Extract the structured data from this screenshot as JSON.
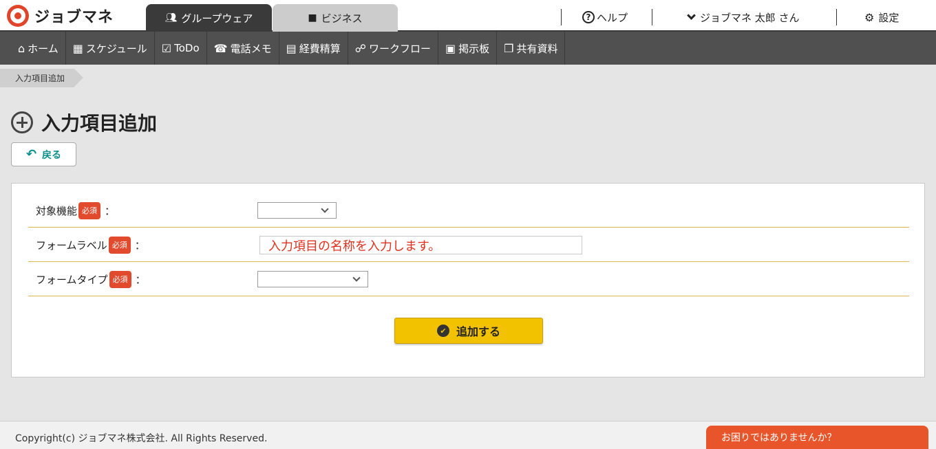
{
  "brand": {
    "name": "ジョブマネ"
  },
  "header": {
    "tabs": [
      {
        "label": "グループウェア",
        "icon": "users-icon",
        "active": true
      },
      {
        "label": "ビジネス",
        "icon": "briefcase-icon",
        "active": false
      }
    ],
    "help_label": "ヘルプ",
    "user_label": "ジョブマネ 太郎 さん",
    "settings_label": "設定"
  },
  "nav": {
    "items": [
      {
        "label": "ホーム",
        "icon": "home-icon"
      },
      {
        "label": "スケジュール",
        "icon": "calendar-icon"
      },
      {
        "label": "ToDo",
        "icon": "clipboard-check-icon"
      },
      {
        "label": "電話メモ",
        "icon": "phone-icon"
      },
      {
        "label": "経費精算",
        "icon": "calculator-icon"
      },
      {
        "label": "ワークフロー",
        "icon": "workflow-icon"
      },
      {
        "label": "掲示板",
        "icon": "board-icon"
      },
      {
        "label": "共有資料",
        "icon": "documents-icon"
      }
    ]
  },
  "breadcrumb": {
    "current": "入力項目追加"
  },
  "page": {
    "title": "入力項目追加",
    "back_label": "戻る"
  },
  "form": {
    "required_badge": "必須",
    "colon": "：",
    "fields": [
      {
        "label": "対象機能",
        "type": "select",
        "value": ""
      },
      {
        "label": "フォームラベル",
        "type": "text",
        "placeholder": "入力項目の名称を入力します。"
      },
      {
        "label": "フォームタイプ",
        "type": "select",
        "value": ""
      }
    ],
    "submit_label": "追加する"
  },
  "footer": {
    "copyright": "Copyright(c) ジョブマネ株式会社. All Rights Reserved.",
    "help_tab": "お困りではありませんか？"
  },
  "colors": {
    "header_dark": "#3a3a3a",
    "nav_bg": "#505050",
    "required": "#e24a2e",
    "submit": "#f2c200",
    "help_tab": "#e8552a",
    "accent_teal": "#0a8f8a"
  }
}
